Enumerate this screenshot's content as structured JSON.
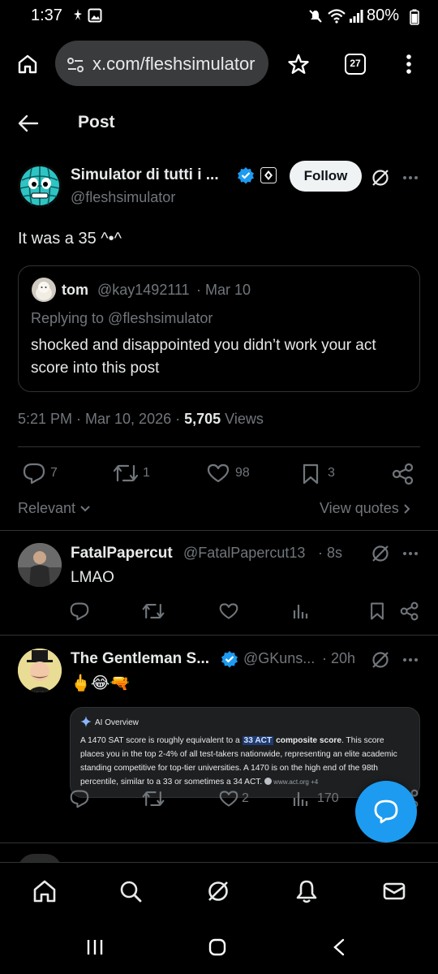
{
  "status_bar": {
    "time": "1:37",
    "battery": "80%"
  },
  "browser": {
    "url": "x.com/fleshsimulator",
    "tab_count": "27"
  },
  "header": {
    "title": "Post"
  },
  "post": {
    "author_name": "Simulator di tutti i ...",
    "author_handle": "@fleshsimulator",
    "follow_label": "Follow",
    "text": "It was a 35 ^•^",
    "quote": {
      "name": "tom",
      "handle": "@kay1492111",
      "date": "· Mar 10",
      "replying": "Replying to @fleshsimulator",
      "text": "shocked and disappointed you didn’t work your act score into this post"
    },
    "timestamp": "5:21 PM · Mar 10, 2026 · ",
    "views_count": "5,705",
    "views_label": " Views",
    "replies": "7",
    "reposts": "1",
    "likes": "98",
    "bookmarks": "3",
    "relevant_label": "Relevant",
    "view_quotes_label": "View quotes"
  },
  "replies": [
    {
      "name": "FatalPapercut",
      "handle": "@FatalPapercut13",
      "time": "· 8s",
      "text": "LMAO"
    },
    {
      "name": "The Gentleman S...",
      "handle": "@GKuns...",
      "time": "· 20h",
      "text": "🖕😂🔫",
      "ai_card": {
        "title": "AI Overview",
        "text_part1": "A 1470 SAT score is roughly equivalent to a ",
        "highlight": "33 ACT",
        "text_part2": " composite score",
        "text_part3": ". This score places you in the top 2-4% of all test-takers nationwide, representing an elite academic standing competitive for top-tier universities. A 1470 is on the high end of the 98th percentile, similar to a 33 or sometimes a 34 ACT.",
        "source": "www.act.org +4"
      },
      "likes": "2",
      "views": "170"
    }
  ],
  "colors": {
    "accent": "#1d9bf0",
    "muted": "#71767b",
    "divider": "#2f3336",
    "background": "#000000"
  }
}
